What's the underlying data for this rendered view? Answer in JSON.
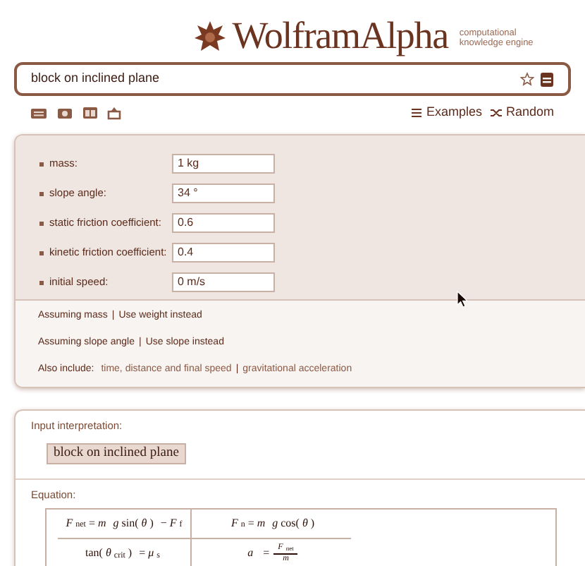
{
  "logo": {
    "name": "WolframAlpha",
    "tagline": [
      "computational",
      "knowledge engine"
    ]
  },
  "search": {
    "value": "block on inclined plane"
  },
  "toolbar": {
    "links": [
      "Examples",
      "Random"
    ]
  },
  "parameters": [
    {
      "label": "mass:",
      "value": "1 kg"
    },
    {
      "label": "slope angle:",
      "value": "34 °"
    },
    {
      "label": "static friction coefficient:",
      "value": "0.6"
    },
    {
      "label": "kinetic friction coefficient:",
      "value": "0.4"
    },
    {
      "label": "initial speed:",
      "value": "0 m/s"
    }
  ],
  "assumptions": [
    {
      "prefix": "Assuming mass",
      "separator": "|",
      "link": "Use weight instead"
    },
    {
      "prefix": "Assuming slope angle",
      "separator": "|",
      "link": "Use slope instead"
    }
  ],
  "also_include": {
    "label": "Also include:",
    "links": [
      "time, distance and final speed",
      "gravitational acceleration"
    ],
    "separator": "|"
  },
  "input_interpretation": {
    "title": "Input interpretation:",
    "value": "block on inclined plane"
  },
  "equation": {
    "title": "Equation:",
    "rows": [
      [
        {
          "kind": "text",
          "text": "*F*$_{net}$ = *m g* sin(*θ*) − *F*$_{f}$"
        },
        {
          "kind": "text",
          "text": "*F*$_{n}$ = *m g* cos(*θ*)"
        }
      ],
      [
        {
          "kind": "text",
          "text": "tan(*θ*$_{crit}$) = *μ*$_{s}$"
        },
        {
          "kind": "fraction",
          "lhs": "*a* =",
          "numerator": "*F*$_{net}$",
          "denominator": "*m*"
        }
      ]
    ]
  }
}
